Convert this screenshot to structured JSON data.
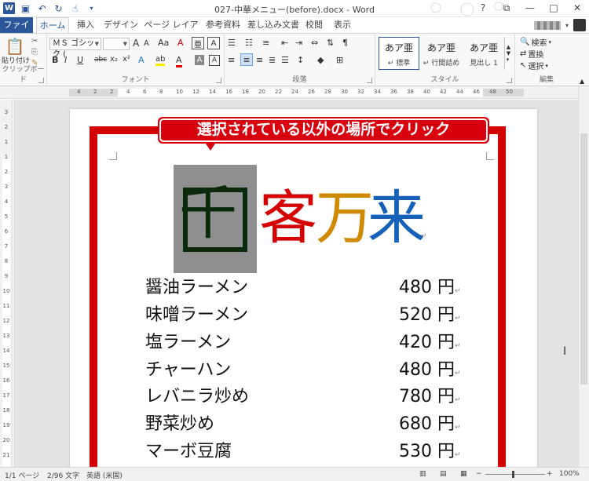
{
  "app": {
    "title": "027-中華メニュー(before).docx - Word",
    "window_controls": {
      "help": "?",
      "restore": "⧉",
      "minimize": "—",
      "maximize": "□",
      "close": "✕"
    }
  },
  "tabs": [
    {
      "label": "ファイル"
    },
    {
      "label": "ホーム"
    },
    {
      "label": "挿入"
    },
    {
      "label": "デザイン"
    },
    {
      "label": "ページ レイアウト"
    },
    {
      "label": "参考資料"
    },
    {
      "label": "差し込み文書"
    },
    {
      "label": "校閲"
    },
    {
      "label": "表示"
    }
  ],
  "ribbon": {
    "clipboard": {
      "paste": "貼り付け",
      "label": "クリップボード"
    },
    "font": {
      "name": "ＭＳ ゴシック (",
      "label": "フォント",
      "buttons": {
        "bold": "B",
        "italic": "I",
        "underline": "U",
        "strike": "abc",
        "sub": "x₂",
        "sup": "x²",
        "grow": "A",
        "shrink": "A",
        "case": "Aa",
        "clear": "A",
        "effects": "A",
        "highlight": "ab",
        "color": "A",
        "shade": "A",
        "border": "A"
      }
    },
    "paragraph": {
      "label": "段落"
    },
    "styles": {
      "label": "スタイル",
      "items": [
        {
          "preview": "あア亜",
          "name": "↵ 標準"
        },
        {
          "preview": "あア亜",
          "name": "↵ 行間詰め"
        },
        {
          "preview": "あア亜",
          "name": "見出し 1"
        }
      ]
    },
    "editing": {
      "label": "編集",
      "find": "検索",
      "replace": "置換",
      "select": "選択"
    }
  },
  "ruler": {
    "marks": [
      "4",
      "2",
      "2",
      "4",
      "6",
      "8",
      "10",
      "12",
      "14",
      "16",
      "18",
      "20",
      "22",
      "24",
      "26",
      "28",
      "30",
      "32",
      "34",
      "36",
      "38",
      "40",
      "42",
      "44",
      "46",
      "48",
      "50"
    ],
    "vmarks": [
      "3",
      "2",
      "1",
      "1",
      "2",
      "3",
      "4",
      "5",
      "6",
      "7",
      "8",
      "9",
      "10",
      "11",
      "12",
      "13",
      "14",
      "15",
      "16",
      "17",
      "18",
      "19",
      "20",
      "21"
    ]
  },
  "document": {
    "callout": "選択されている以外の場所でクリック",
    "title_chars": [
      "千",
      "客",
      "万",
      "来"
    ],
    "menu": [
      {
        "name": "醤油ラーメン",
        "price": "480 円"
      },
      {
        "name": "味噌ラーメン",
        "price": "520 円"
      },
      {
        "name": "塩ラーメン",
        "price": "420 円"
      },
      {
        "name": "チャーハン",
        "price": "480 円"
      },
      {
        "name": "レバニラ炒め",
        "price": "780 円"
      },
      {
        "name": "野菜炒め",
        "price": "680 円"
      },
      {
        "name": "マーボ豆腐",
        "price": "530 円"
      }
    ]
  },
  "status": {
    "page": "1/1 ページ",
    "words": "2/96 文字",
    "lang": "英語 (米国)",
    "zoom": "100%",
    "zoom_minus": "−",
    "zoom_plus": "+"
  }
}
